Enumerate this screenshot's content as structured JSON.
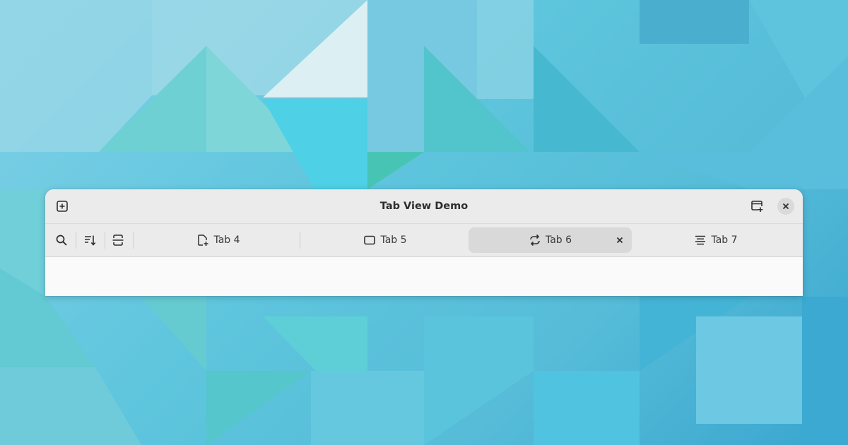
{
  "window": {
    "title": "Tab View Demo"
  },
  "headerbar": {
    "left_button_icon": "tab-new-icon",
    "right_button_icon": "window-new-icon",
    "close_icon": "close-icon"
  },
  "tabbar": {
    "toolbar_icons": [
      "search-icon",
      "sort-descending-icon",
      "tab-overview-icon"
    ],
    "tabs": [
      {
        "label": "Tab 4",
        "icon": "document-new-icon",
        "active": false
      },
      {
        "label": "Tab 5",
        "icon": "monitor-icon",
        "active": false
      },
      {
        "label": "Tab 6",
        "icon": "refresh-icon",
        "active": true,
        "close_icon": "close-icon"
      },
      {
        "label": "Tab 7",
        "icon": "text-justify-icon",
        "active": false
      }
    ]
  },
  "colors": {
    "headerbar_bg": "#ebebeb",
    "active_tab_bg": "#d9d9d9",
    "content_bg": "#fafafa",
    "text": "#2e2e2e"
  }
}
